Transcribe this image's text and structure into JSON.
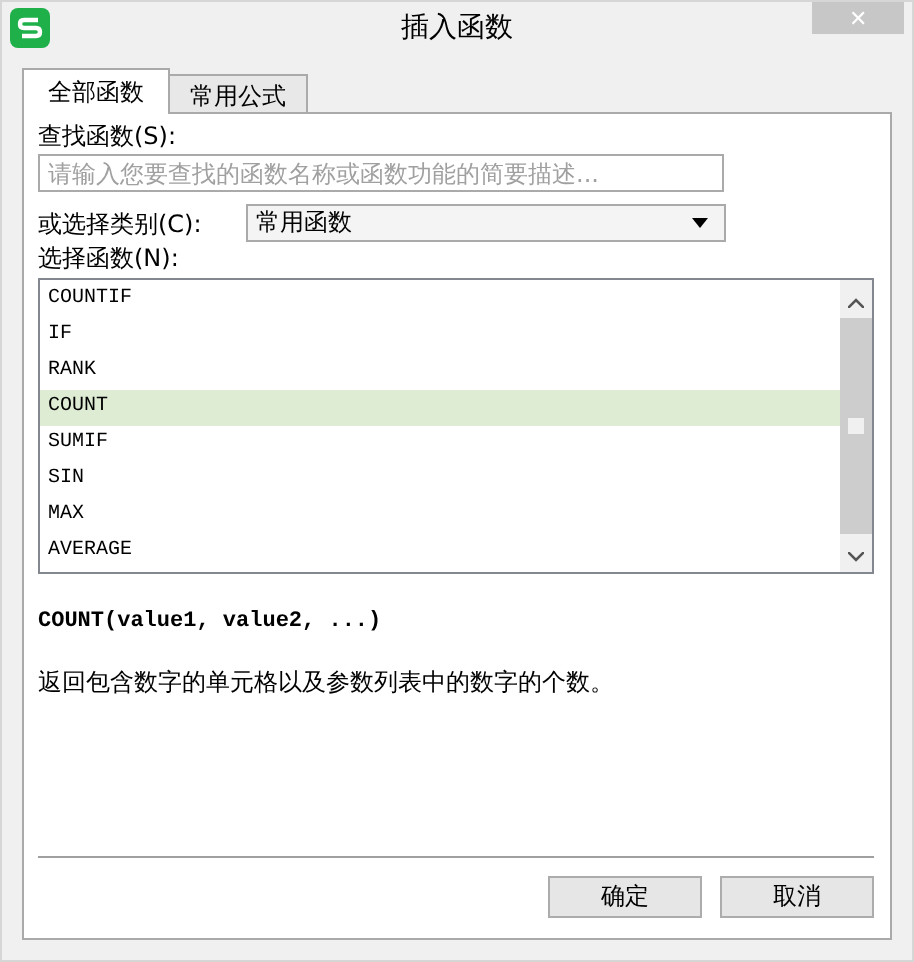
{
  "window": {
    "title": "插入函数",
    "close": "✕"
  },
  "tabs": [
    {
      "label": "全部函数",
      "selected": true
    },
    {
      "label": "常用公式",
      "selected": false
    }
  ],
  "search": {
    "label": "查找函数(S):",
    "placeholder": "请输入您要查找的函数名称或函数功能的简要描述..."
  },
  "category": {
    "label": "或选择类别(C):",
    "value": "常用函数"
  },
  "function_list": {
    "label": "选择函数(N):",
    "items": [
      {
        "name": "COUNTIF",
        "selected": false
      },
      {
        "name": "IF",
        "selected": false
      },
      {
        "name": "RANK",
        "selected": false
      },
      {
        "name": "COUNT",
        "selected": true
      },
      {
        "name": "SUMIF",
        "selected": false
      },
      {
        "name": "SIN",
        "selected": false
      },
      {
        "name": "MAX",
        "selected": false
      },
      {
        "name": "AVERAGE",
        "selected": false
      }
    ]
  },
  "syntax": "COUNT(value1, value2, ...)",
  "description": "返回包含数字的单元格以及参数列表中的数字的个数。",
  "buttons": [
    "确定",
    "取消"
  ]
}
